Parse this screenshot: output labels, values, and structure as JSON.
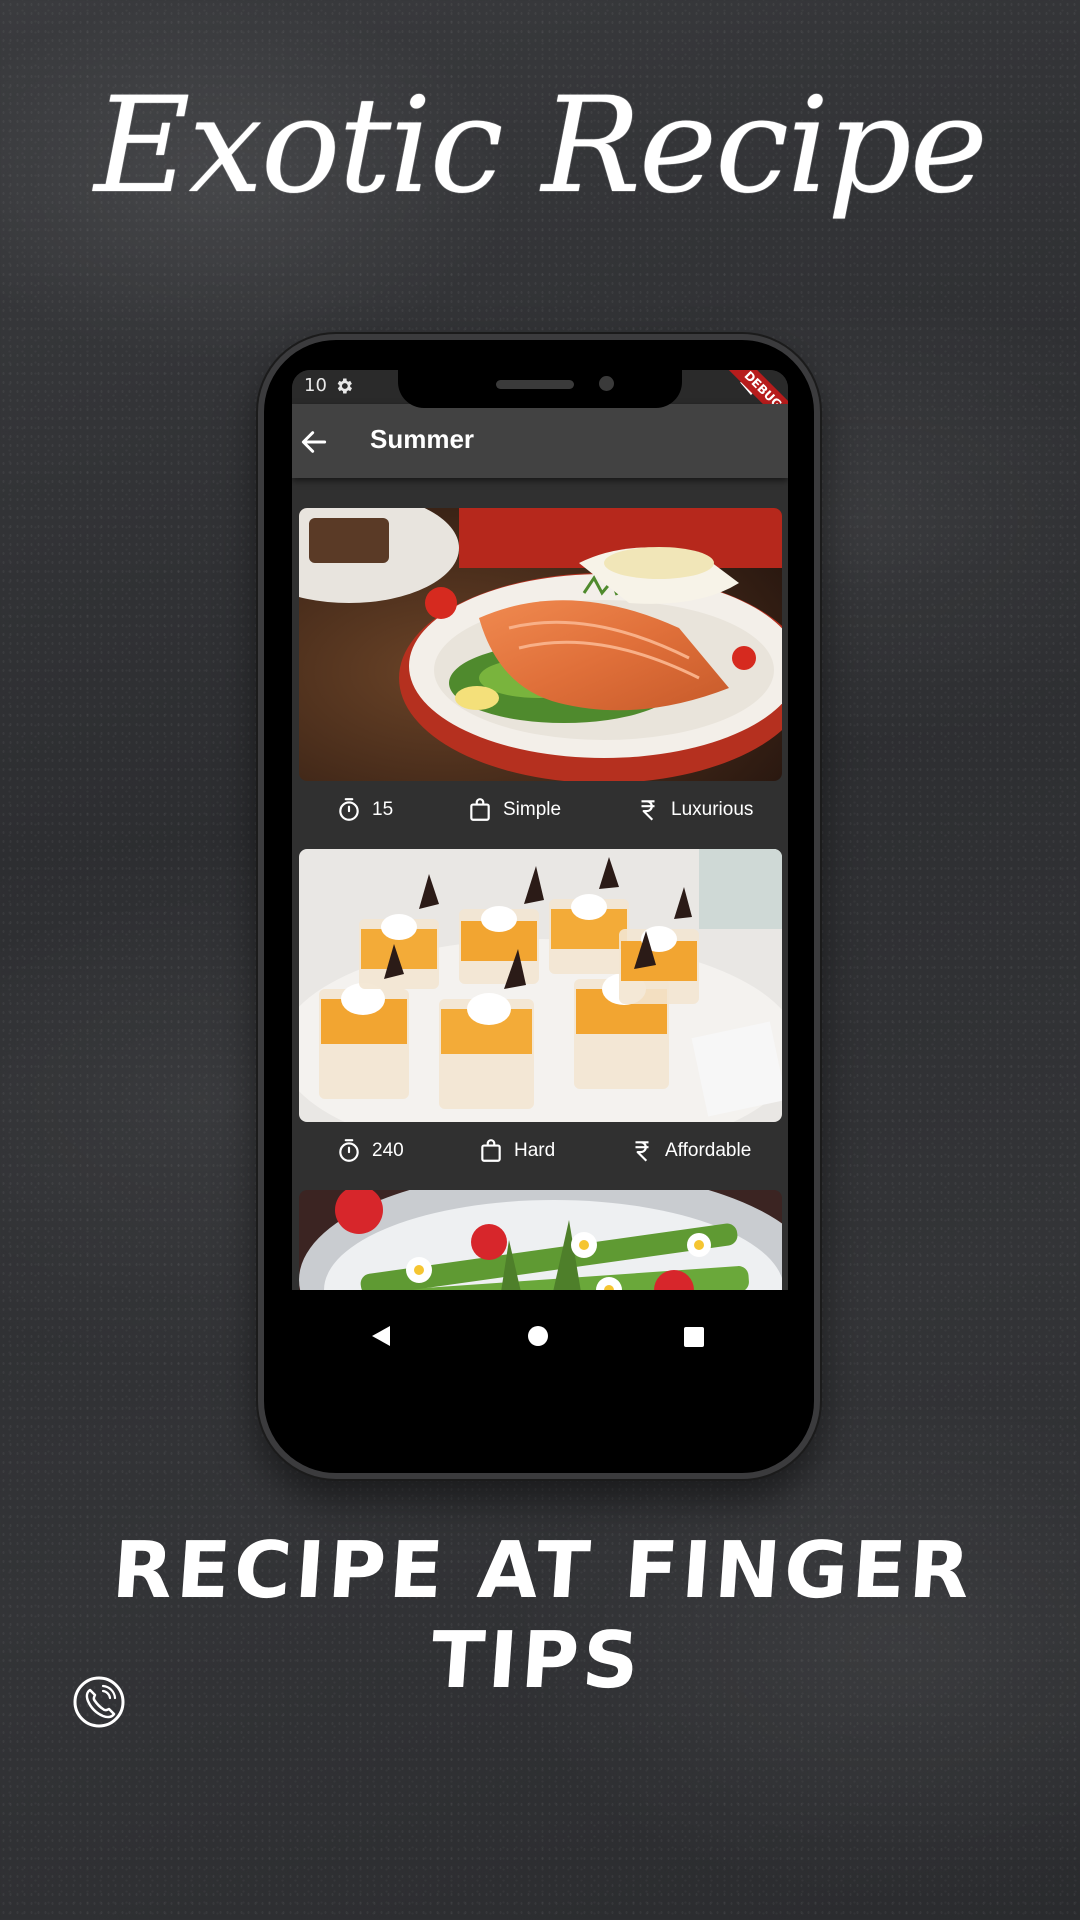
{
  "poster": {
    "title": "Exotic Recipe",
    "tagline": "RECIPE AT FINGER TIPS",
    "contact_icon": "phone-call-icon"
  },
  "status_bar": {
    "time": "10",
    "settings_icon": "gear-icon",
    "wifi_icon": "wifi-icon",
    "debug_banner": "DEBUG"
  },
  "app_bar": {
    "back_icon": "arrow-left-icon",
    "title": "Summer"
  },
  "recipes": [
    {
      "image": "smoked-salmon-plate",
      "duration": "15",
      "complexity": "Simple",
      "affordability": "Luxurious"
    },
    {
      "image": "mango-pudding-cups",
      "duration": "240",
      "complexity": "Hard",
      "affordability": "Affordable"
    },
    {
      "image": "asparagus-strawberry-salad"
    }
  ],
  "icons": {
    "duration": "timer-icon",
    "complexity": "shopping-bag-icon",
    "affordability": "rupee-icon"
  },
  "nav_bar": {
    "back": "nav-back-triangle-icon",
    "home": "nav-home-circle-icon",
    "recents": "nav-recents-square-icon"
  },
  "colors": {
    "background": "#2f3033",
    "app_bar": "#424242",
    "screen": "#303030",
    "debug_banner": "#b71c1c"
  }
}
